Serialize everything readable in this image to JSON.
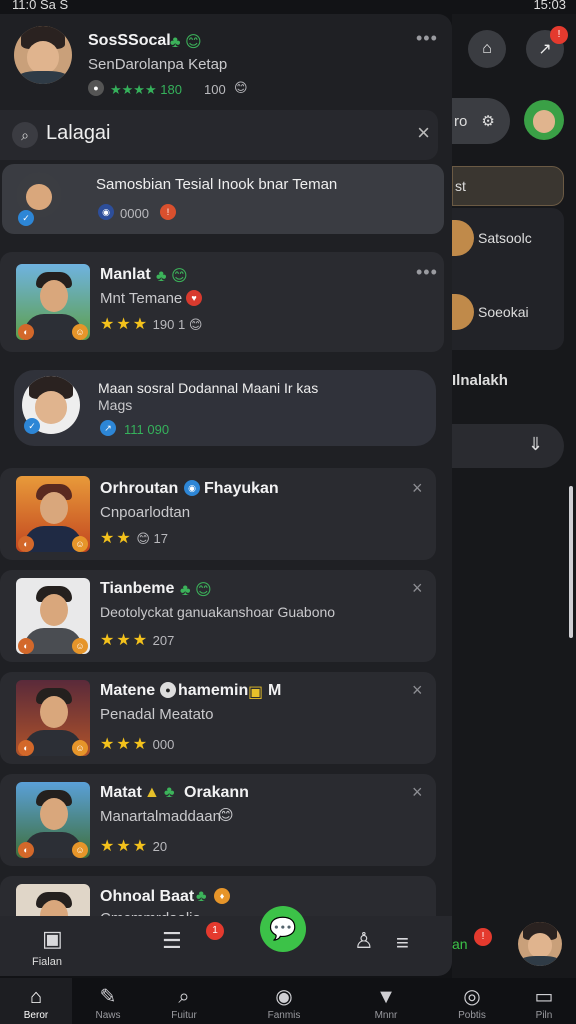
{
  "status": {
    "time_left": "11:0 Sa S",
    "time_right": "15:03"
  },
  "profile": {
    "name": "SosSSocal",
    "name_emoji": "♣ 😊",
    "subtitle": "SenDarolanpa Ketap",
    "rating_text": "★★★★ 180",
    "count": "100"
  },
  "search": {
    "value": "Lalagai"
  },
  "highlight": {
    "title": "Samosbian Tesial Inook bnar Teman",
    "meta": "0000"
  },
  "items": [
    {
      "name": "Manlat",
      "sub": "Mnt Temane",
      "rating": "190",
      "extra": "1"
    },
    {
      "name": "Orhroutan",
      "name2": "Fhayukan",
      "sub": "Cnpoarlodtan",
      "rating": "17"
    },
    {
      "name": "Tianbeme",
      "sub": "Deotolyckat ganuakanshoar Guabono",
      "rating": "207"
    },
    {
      "name": "Matene",
      "name2": "hamemin",
      "name3": "M",
      "sub": "Penadal Meatato",
      "rating": "000"
    },
    {
      "name": "Matat",
      "name2": "Orakann",
      "sub": "Manartalmaddaan",
      "rating": "20"
    },
    {
      "name": "Ohnoal Baat",
      "sub": "Cmcmmrdaalia"
    }
  ],
  "bubble": {
    "line1": "Maan sosral Dodannal Maani Ir kas",
    "line2": "Mags",
    "meta": "111 090"
  },
  "right_panel": {
    "pill_text": "ro",
    "card_label": "st",
    "item1": "Satsoolc",
    "item2": "Soeokai",
    "section": "Ilnalakh",
    "notif_label": "an"
  },
  "drawer_nav": {
    "home_label": "Fialan",
    "badge": "1"
  },
  "tabs": [
    {
      "label": "Beror"
    },
    {
      "label": "Naws"
    },
    {
      "label": "Fuitur"
    },
    {
      "label": "Fanmis"
    },
    {
      "label": "Mnnr"
    },
    {
      "label": "Pobtis"
    },
    {
      "label": "Piln"
    }
  ],
  "colors": {
    "accent_green": "#3cc248",
    "star": "#f4c21c",
    "badge_red": "#e43a2e"
  }
}
